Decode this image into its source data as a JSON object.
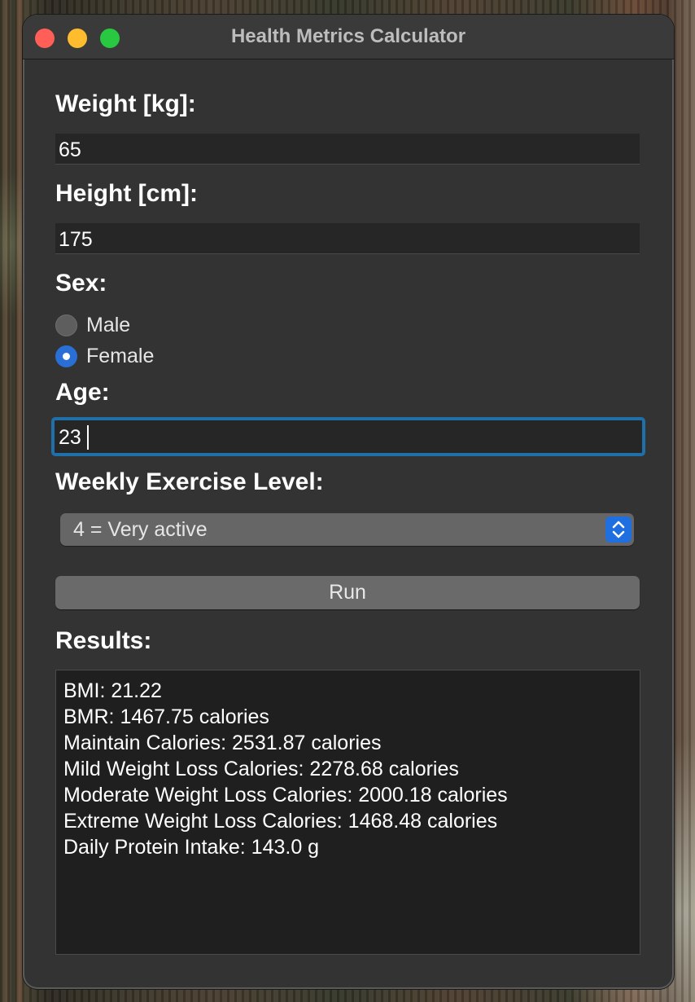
{
  "window": {
    "title": "Health Metrics Calculator"
  },
  "form": {
    "weight": {
      "label": "Weight [kg]:",
      "value": "65"
    },
    "height": {
      "label": "Height [cm]:",
      "value": "175"
    },
    "sex": {
      "label": "Sex:",
      "options": [
        {
          "label": "Male",
          "selected": false
        },
        {
          "label": "Female",
          "selected": true
        }
      ]
    },
    "age": {
      "label": "Age:",
      "value": "23"
    },
    "exercise": {
      "label": "Weekly Exercise Level:",
      "selected": "4 = Very active"
    },
    "run_label": "Run"
  },
  "results": {
    "label": "Results:",
    "lines": [
      "BMI: 21.22",
      "BMR: 1467.75 calories",
      "Maintain Calories: 2531.87 calories",
      "Mild Weight Loss Calories: 2278.68 calories",
      "Moderate Weight Loss Calories: 2000.18 calories",
      "Extreme Weight Loss Calories: 1468.48 calories",
      "Daily Protein Intake: 143.0 g"
    ]
  },
  "colors": {
    "accent": "#2a6fd6",
    "focus_ring": "#1f6fa8",
    "close": "#ff5f57",
    "minimize": "#febc2e",
    "zoom": "#28c840"
  }
}
